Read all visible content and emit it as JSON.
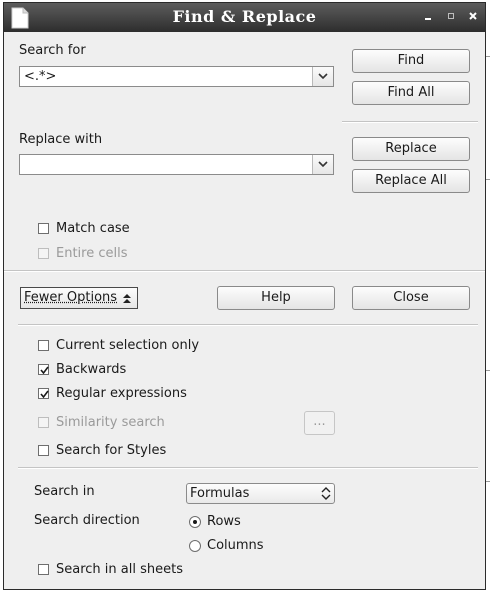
{
  "window": {
    "title": "Find & Replace"
  },
  "search": {
    "label": "Search for",
    "value": "<.*>"
  },
  "replace": {
    "label": "Replace with",
    "value": ""
  },
  "buttons": {
    "find": "Find",
    "find_all": "Find All",
    "replace": "Replace",
    "replace_all": "Replace All",
    "fewer_options": "Fewer Options",
    "help": "Help",
    "close": "Close",
    "similarity_settings": "..."
  },
  "options": {
    "match_case": {
      "label": "Match case",
      "checked": false,
      "enabled": true
    },
    "entire_cells": {
      "label": "Entire cells",
      "checked": false,
      "enabled": false
    },
    "current_selection_only": {
      "label": "Current selection only",
      "checked": false,
      "enabled": true
    },
    "backwards": {
      "label": "Backwards",
      "checked": true,
      "enabled": true
    },
    "regular_expressions": {
      "label": "Regular expressions",
      "checked": true,
      "enabled": true
    },
    "similarity_search": {
      "label": "Similarity search",
      "checked": false,
      "enabled": false
    },
    "search_for_styles": {
      "label": "Search for Styles",
      "checked": false,
      "enabled": true
    },
    "search_all_sheets": {
      "label": "Search in all sheets",
      "checked": false,
      "enabled": true
    }
  },
  "search_in": {
    "label": "Search in",
    "value": "Formulas"
  },
  "search_direction": {
    "label": "Search direction",
    "rows": "Rows",
    "columns": "Columns",
    "selected": "Rows"
  }
}
